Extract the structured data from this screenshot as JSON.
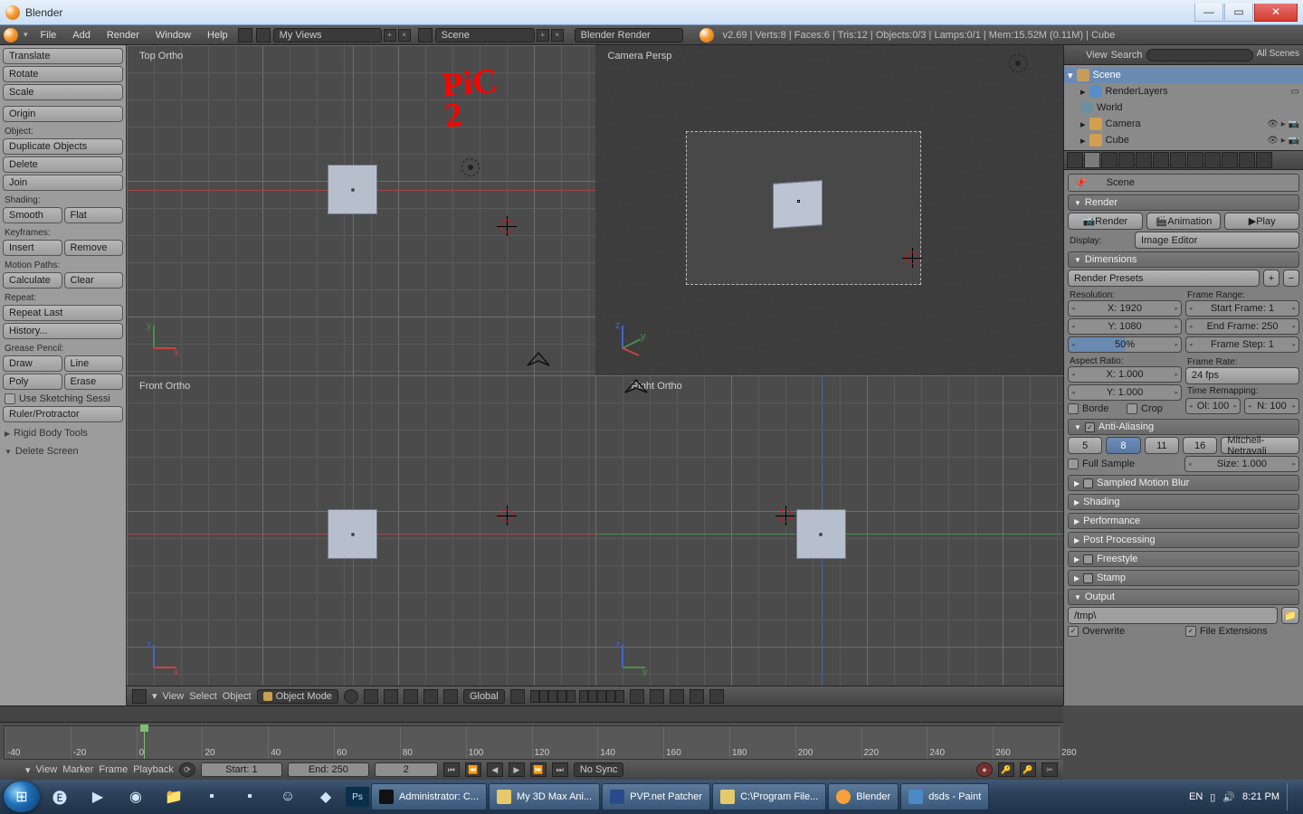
{
  "window": {
    "title": "Blender"
  },
  "wincontrols": {
    "min": "—",
    "max": "▭",
    "close": "✕"
  },
  "top_menu": {
    "items": [
      "File",
      "Add",
      "Render",
      "Window",
      "Help"
    ],
    "screen_layout": "My Views",
    "scene": "Scene",
    "engine": "Blender Render",
    "stats": "v2.69 | Verts:8 | Faces:6 | Tris:12 | Objects:0/3 | Lamps:0/1 | Mem:15.52M (0.11M) | Cube"
  },
  "toolshelf": {
    "transform": [
      "Translate",
      "Rotate",
      "Scale"
    ],
    "origin": "Origin",
    "object_label": "Object:",
    "object": [
      "Duplicate Objects",
      "Delete",
      "Join"
    ],
    "shading_label": "Shading:",
    "shading": [
      "Smooth",
      "Flat"
    ],
    "keyframes_label": "Keyframes:",
    "keyframes": [
      "Insert",
      "Remove"
    ],
    "motion_label": "Motion Paths:",
    "motion": [
      "Calculate",
      "Clear"
    ],
    "repeat_label": "Repeat:",
    "repeat": [
      "Repeat Last",
      "History..."
    ],
    "grease_label": "Grease Pencil:",
    "grease_row1": [
      "Draw",
      "Line"
    ],
    "grease_row2": [
      "Poly",
      "Erase"
    ],
    "sketch": "Use Sketching Sessi",
    "ruler": "Ruler/Protractor",
    "rigid": "Rigid Body Tools",
    "delscreen": "Delete Screen"
  },
  "viewports": {
    "top": "Top Ortho",
    "camera": "Camera Persp",
    "front": "Front Ortho",
    "right": "Right Ortho",
    "scribble": "PiC\n2"
  },
  "vp_header": {
    "view": "View",
    "select": "Select",
    "object": "Object",
    "mode": "Object Mode",
    "orient": "Global"
  },
  "outliner": {
    "view": "View",
    "search": "Search",
    "filter": "All Scenes",
    "scene": "Scene",
    "render": "RenderLayers",
    "world": "World",
    "camera": "Camera",
    "cube": "Cube"
  },
  "props": {
    "crumb1": "Scene",
    "p_render": "Render",
    "btn_render": "Render",
    "btn_anim": "Animation",
    "btn_play": "Play",
    "display_lbl": "Display:",
    "display_val": "Image Editor",
    "p_dim": "Dimensions",
    "render_presets": "Render Presets",
    "res_lbl": "Resolution:",
    "res_x": "X: 1920",
    "res_y": "Y: 1080",
    "res_pct": "50%",
    "fr_lbl": "Frame Range:",
    "fr_start": "Start Frame: 1",
    "fr_end": "End Frame: 250",
    "fr_step": "Frame Step: 1",
    "ar_lbl": "Aspect Ratio:",
    "ar_x": "X: 1.000",
    "ar_y": "Y: 1.000",
    "frate_lbl": "Frame Rate:",
    "frate": "24 fps",
    "tremap_lbl": "Time Remapping:",
    "tremap_old": "Ol: 100",
    "tremap_new": "N: 100",
    "border": "Borde",
    "crop": "Crop",
    "p_aa": "Anti-Aliasing",
    "aa": [
      "5",
      "8",
      "11",
      "16"
    ],
    "aa_filter": "Mitchell-Netravali",
    "full_sample": "Full Sample",
    "aa_size": "Size: 1.000",
    "p_smb": "Sampled Motion Blur",
    "p_shading": "Shading",
    "p_perf": "Performance",
    "p_post": "Post Processing",
    "p_freestyle": "Freestyle",
    "p_stamp": "Stamp",
    "p_output": "Output",
    "output_path": "/tmp\\",
    "overwrite": "Overwrite",
    "fileext": "File Extensions"
  },
  "timeline": {
    "ticks": [
      "-40",
      "-20",
      "0",
      "20",
      "40",
      "60",
      "80",
      "100",
      "120",
      "140",
      "160",
      "180",
      "200",
      "220",
      "240",
      "260",
      "280"
    ],
    "view": "View",
    "marker": "Marker",
    "frame": "Frame",
    "playback": "Playback",
    "start": "Start: 1",
    "end": "End: 250",
    "current": "2",
    "sync": "No Sync"
  },
  "taskbar": {
    "tasks": [
      "Administrator: C...",
      "My 3D Max Ani...",
      "PVP.net Patcher",
      "C:\\Program File...",
      "Blender",
      "dsds - Paint"
    ],
    "lang": "EN",
    "time": "8:21 PM"
  }
}
